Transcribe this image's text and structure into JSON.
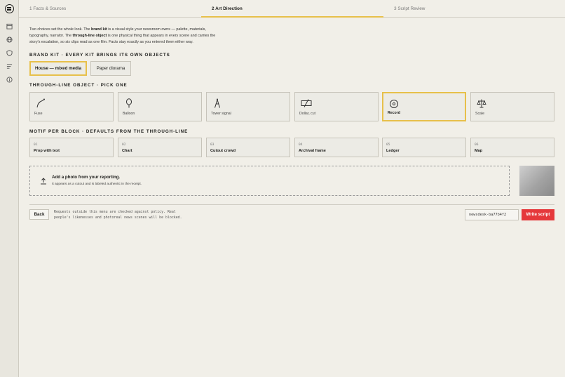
{
  "tabs": [
    {
      "label": "1 Facts & Sources"
    },
    {
      "label": "2 Art Direction"
    },
    {
      "label": "3 Script Review"
    }
  ],
  "intro": {
    "p1": "Two choices set the whole look. The ",
    "brand_kit": "brand kit",
    "p2": " is a visual style your newsroom owns — palette, materials, typography, narrator. The ",
    "through_line": "through-line object",
    "p3": " is one physical thing that appears in every scene and carries the story's escalation, so six clips read as one film. Facts stay exactly as you entered them either way."
  },
  "brand_kit": {
    "title": "BRAND KIT · EVERY KIT BRINGS ITS OWN OBJECTS",
    "options": [
      "House — mixed media",
      "Paper diorama"
    ],
    "selected": "House — mixed media"
  },
  "through_line": {
    "title": "THROUGH-LINE OBJECT · PICK ONE",
    "options": [
      {
        "label": "Fuse",
        "icon": "fuse-icon"
      },
      {
        "label": "Balloon",
        "icon": "balloon-icon"
      },
      {
        "label": "Tower signal",
        "icon": "tower-icon"
      },
      {
        "label": "Dollar, cut",
        "icon": "dollar-cut-icon"
      },
      {
        "label": "Record",
        "icon": "record-icon"
      },
      {
        "label": "Scale",
        "icon": "scale-icon"
      }
    ],
    "selected": "Record"
  },
  "motif": {
    "title": "MOTIF PER BLOCK · DEFAULTS FROM THE THROUGH-LINE",
    "blocks": [
      {
        "num": "01",
        "name": "Prop with text"
      },
      {
        "num": "02",
        "name": "Chart"
      },
      {
        "num": "03",
        "name": "Cutout crowd"
      },
      {
        "num": "04",
        "name": "Archival frame"
      },
      {
        "num": "05",
        "name": "Ledger"
      },
      {
        "num": "06",
        "name": "Map"
      }
    ]
  },
  "upload": {
    "title": "Add a photo from your reporting.",
    "subtitle": "It appears as a cutout and is labeled authentic in the receipt."
  },
  "footer": {
    "back": "Back",
    "policy": "Requests outside this menu are checked against policy. Real people's likenesses and photoreal news scenes will be blocked.",
    "session_id": "newsdesk-ba77b4f2",
    "write_script": "Write script"
  },
  "colors": {
    "accent": "#e7c04a",
    "primary": "#e5383b",
    "background": "#f1efe8"
  }
}
